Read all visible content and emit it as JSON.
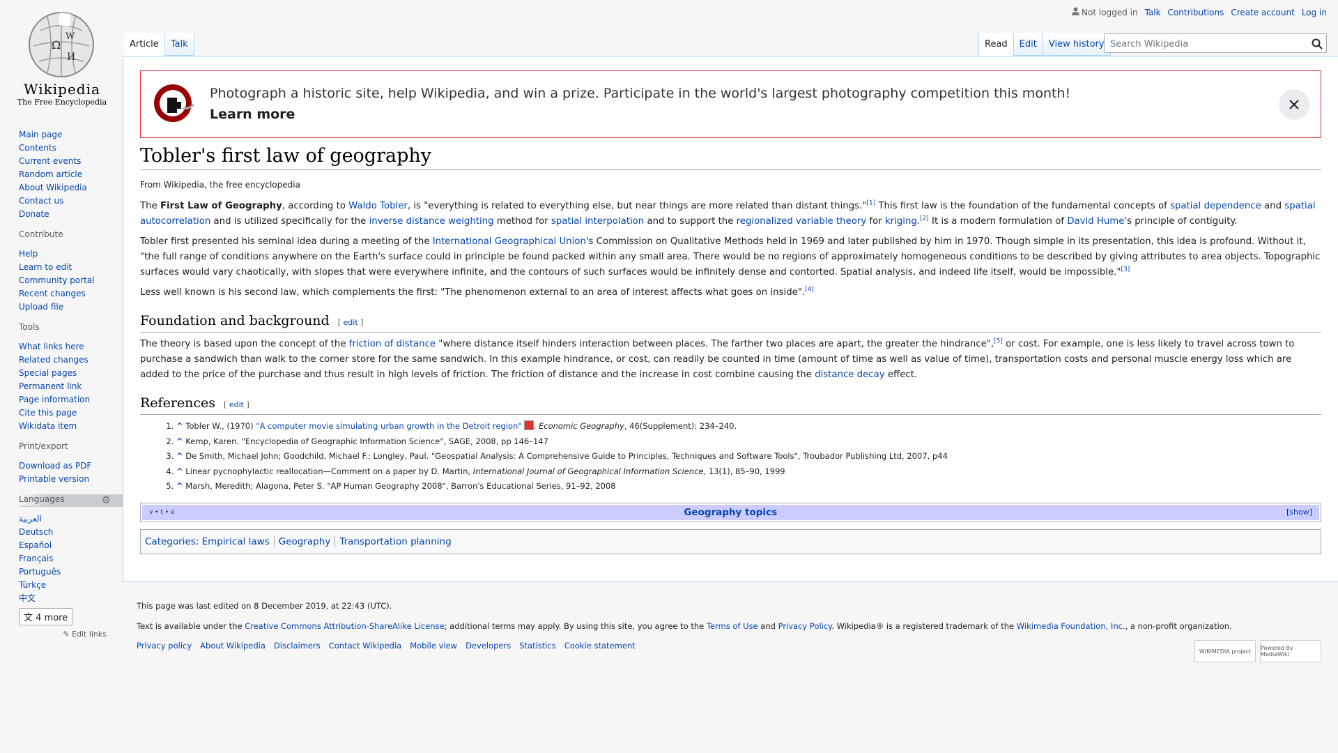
{
  "logo": {
    "wordmark": "Wikipedia",
    "tagline": "The Free Encyclopedia"
  },
  "personal": {
    "anon": "Not logged in",
    "links": [
      "Talk",
      "Contributions",
      "Create account",
      "Log in"
    ]
  },
  "tabs": {
    "left": [
      "Article",
      "Talk"
    ],
    "right": [
      "Read",
      "Edit",
      "View history"
    ]
  },
  "search": {
    "placeholder": "Search Wikipedia"
  },
  "sidebar": {
    "nav": [
      "Main page",
      "Contents",
      "Current events",
      "Random article",
      "About Wikipedia",
      "Contact us",
      "Donate"
    ],
    "contribute_heading": "Contribute",
    "contribute": [
      "Help",
      "Learn to edit",
      "Community portal",
      "Recent changes",
      "Upload file"
    ],
    "tools_heading": "Tools",
    "tools": [
      "What links here",
      "Related changes",
      "Special pages",
      "Permanent link",
      "Page information",
      "Cite this page",
      "Wikidata item"
    ],
    "print_heading": "Print/export",
    "print": [
      "Download as PDF",
      "Printable version"
    ],
    "languages_heading": "Languages",
    "languages": [
      "العربية",
      "Deutsch",
      "Español",
      "Français",
      "Português",
      "Türkçe",
      "中文"
    ],
    "more_label": "4 more",
    "edit_links": "Edit links"
  },
  "banner": {
    "message": "Photograph a historic site, help Wikipedia, and win a prize. Participate in the world's largest photography competition this month!",
    "cta": "Learn more"
  },
  "article": {
    "title": "Tobler's first law of geography",
    "tagline": "From Wikipedia, the free encyclopedia",
    "p1": {
      "t1": "The ",
      "bold": "First Law of Geography",
      "t2": ", according to ",
      "l1": "Waldo Tobler",
      "t3": ", is \"everything is related to everything else, but near things are more related than distant things.\"",
      "r1": "[1]",
      "t4": " This first law is the foundation of the fundamental concepts of ",
      "l2": "spatial dependence",
      "t5": " and ",
      "l3": "spatial autocorrelation",
      "t6": " and is utilized specifically for the ",
      "l4": "inverse distance weighting",
      "t7": " method for ",
      "l5": "spatial interpolation",
      "t8": " and to support the ",
      "l6": "regionalized variable theory",
      "t9": " for ",
      "l7": "kriging",
      "t10": ".",
      "r2": "[2]",
      "t11": " It is a modern formulation of ",
      "l8": "David Hume",
      "t12": "'s principle of contiguity."
    },
    "p2": {
      "t1": "Tobler first presented his seminal idea during a meeting of the ",
      "l1": "International Geographical Union",
      "t2": "'s Commission on Qualitative Methods held in 1969 and later published by him in 1970. Though simple in its presentation, this idea is profound. Without it, \"the full range of conditions anywhere on the Earth's surface could in principle be found packed within any small area. There would be no regions of approximately homogeneous conditions to be described by giving attributes to area objects. Topographic surfaces would vary chaotically, with slopes that were everywhere infinite, and the contours of such surfaces would be infinitely dense and contorted. Spatial analysis, and indeed life itself, would be impossible.\"",
      "r1": "[3]"
    },
    "p3": {
      "t1": "Less well known is his second law, which complements the first: \"The phenomenon external to an area of interest affects what goes on inside\".",
      "r1": "[4]"
    },
    "h_foundation": "Foundation and background",
    "edit_label": "edit",
    "p4": {
      "t1": "The theory is based upon the concept of the ",
      "l1": "friction of distance",
      "t2": " \"where distance itself hinders interaction between places. The farther two places are apart, the greater the hindrance\",",
      "r1": "[5]",
      "t3": " or cost. For example, one is less likely to travel across town to purchase a sandwich than walk to the corner store for the same sandwich. In this example hindrance, or cost, can readily be counted in time (amount of time as well as value of time), transportation costs and personal muscle energy loss which are added to the price of the purchase and thus result in high levels of friction. The friction of distance and the increase in cost combine causing the ",
      "l2": "distance decay",
      "t4": " effect."
    },
    "h_references": "References",
    "refs": {
      "r1a": "Tobler W., (1970) ",
      "r1link": "\"A computer movie simulating urban growth in the Detroit region\"",
      "r1b": ". ",
      "r1i": "Economic Geography",
      "r1c": ", 46(Supplement): 234–240.",
      "r2": "Kemp, Karen. \"Encyclopedia of Geographic Information Science\", SAGE, 2008, pp 146–147",
      "r3": "De Smith, Michael John; Goodchild, Michael F.; Longley, Paul. \"Geospatial Analysis: A Comprehensive Guide to Principles, Techniques and Software Tools\", Troubador Publishing Ltd, 2007, p44",
      "r4a": "Linear pycnophylactic reallocation—Comment on a paper by D. Martin, ",
      "r4i": "International Journal of Geographical Information Science",
      "r4b": ", 13(1), 85–90, 1999",
      "r5": "Marsh, Meredith; Alagona, Peter S. \"AP Human Geography 2008\", Barron's Educational Series, 91–92, 2008",
      "caret": "^"
    },
    "navbox": {
      "v": "v",
      "t": "t",
      "e": "e",
      "title": "Geography topics",
      "show": "show"
    },
    "categories": {
      "label": "Categories",
      "items": [
        "Empirical laws",
        "Geography",
        "Transportation planning"
      ]
    }
  },
  "footer": {
    "lastmod": "This page was last edited on 8 December 2019, at 22:43 (UTC).",
    "lic": {
      "t1": "Text is available under the ",
      "l1": "Creative Commons Attribution-ShareAlike License",
      "t2": "; additional terms may apply. By using this site, you agree to the ",
      "l2": "Terms of Use",
      "t3": " and ",
      "l3": "Privacy Policy",
      "t4": ". Wikipedia® is a registered trademark of the ",
      "l4": "Wikimedia Foundation, Inc.",
      "t5": ", a non-profit organization."
    },
    "places": [
      "Privacy policy",
      "About Wikipedia",
      "Disclaimers",
      "Contact Wikipedia",
      "Mobile view",
      "Developers",
      "Statistics",
      "Cookie statement"
    ],
    "icon_wikimedia": "WIKIMEDIA project",
    "icon_mediawiki": "Powered By MediaWiki"
  }
}
